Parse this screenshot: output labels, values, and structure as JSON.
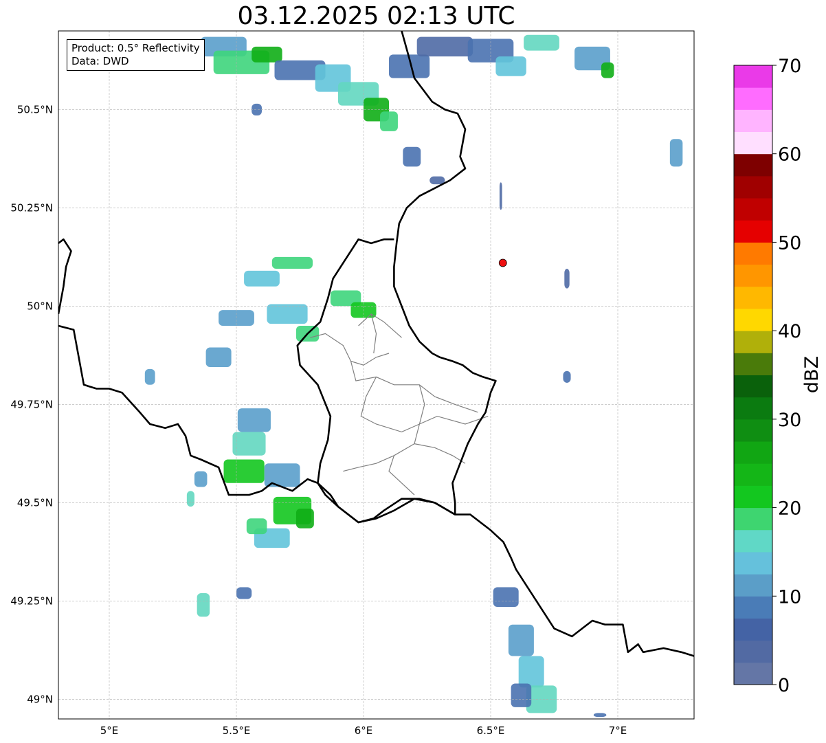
{
  "title": "03.12.2025 02:13 UTC",
  "info": {
    "product": "Product: 0.5° Reflectivity",
    "source": "Data: DWD"
  },
  "map": {
    "lon_range": [
      4.8,
      7.3
    ],
    "lat_range": [
      48.95,
      50.7
    ],
    "lon_ticks": [
      {
        "value": 5.0,
        "label": "5°E"
      },
      {
        "value": 5.5,
        "label": "5.5°E"
      },
      {
        "value": 6.0,
        "label": "6°E"
      },
      {
        "value": 6.5,
        "label": "6.5°E"
      },
      {
        "value": 7.0,
        "label": "7°E"
      }
    ],
    "lat_ticks": [
      {
        "value": 50.5,
        "label": "50.5°N"
      },
      {
        "value": 50.25,
        "label": "50.25°N"
      },
      {
        "value": 50.0,
        "label": "50°N"
      },
      {
        "value": 49.75,
        "label": "49.75°N"
      },
      {
        "value": 49.5,
        "label": "49.5°N"
      },
      {
        "value": 49.25,
        "label": "49.25°N"
      },
      {
        "value": 49.0,
        "label": "49°N"
      }
    ],
    "grid": true,
    "radar_site": {
      "lon": 6.548,
      "lat": 50.11,
      "color": "#ee1111"
    },
    "borders": [
      [
        [
          4.8,
          50.16
        ],
        [
          4.82,
          50.17
        ],
        [
          4.85,
          50.14
        ],
        [
          4.83,
          50.1
        ],
        [
          4.82,
          50.05
        ],
        [
          4.8,
          49.98
        ]
      ],
      [
        [
          4.8,
          49.95
        ],
        [
          4.86,
          49.94
        ],
        [
          4.88,
          49.87
        ],
        [
          4.9,
          49.8
        ],
        [
          4.95,
          49.79
        ],
        [
          5.0,
          49.79
        ],
        [
          5.05,
          49.78
        ],
        [
          5.12,
          49.73
        ],
        [
          5.16,
          49.7
        ],
        [
          5.22,
          49.69
        ],
        [
          5.27,
          49.7
        ],
        [
          5.3,
          49.67
        ],
        [
          5.32,
          49.62
        ],
        [
          5.36,
          49.61
        ],
        [
          5.43,
          49.59
        ],
        [
          5.47,
          49.52
        ],
        [
          5.55,
          49.52
        ],
        [
          5.6,
          49.53
        ],
        [
          5.64,
          49.55
        ],
        [
          5.72,
          49.53
        ],
        [
          5.78,
          49.56
        ],
        [
          5.82,
          49.55
        ],
        [
          5.85,
          49.52
        ],
        [
          5.9,
          49.49
        ],
        [
          5.98,
          49.45
        ],
        [
          6.04,
          49.46
        ],
        [
          6.08,
          49.48
        ],
        [
          6.15,
          49.51
        ],
        [
          6.22,
          49.51
        ],
        [
          6.28,
          49.5
        ],
        [
          6.36,
          49.47
        ],
        [
          6.42,
          49.47
        ],
        [
          6.5,
          49.43
        ],
        [
          6.55,
          49.4
        ],
        [
          6.58,
          49.36
        ],
        [
          6.6,
          49.33
        ],
        [
          6.65,
          49.28
        ],
        [
          6.7,
          49.23
        ],
        [
          6.75,
          49.18
        ],
        [
          6.82,
          49.16
        ],
        [
          6.86,
          49.18
        ],
        [
          6.9,
          49.2
        ],
        [
          6.95,
          49.19
        ],
        [
          7.02,
          49.19
        ],
        [
          7.04,
          49.12
        ],
        [
          7.08,
          49.14
        ],
        [
          7.1,
          49.12
        ],
        [
          7.18,
          49.13
        ],
        [
          7.25,
          49.12
        ],
        [
          7.3,
          49.11
        ]
      ],
      [
        [
          6.36,
          49.47
        ],
        [
          6.36,
          49.5
        ],
        [
          6.35,
          49.55
        ],
        [
          6.38,
          49.6
        ],
        [
          6.41,
          49.65
        ],
        [
          6.45,
          49.7
        ],
        [
          6.48,
          49.73
        ],
        [
          6.5,
          49.78
        ],
        [
          6.52,
          49.81
        ],
        [
          6.47,
          49.82
        ],
        [
          6.43,
          49.83
        ],
        [
          6.39,
          49.85
        ],
        [
          6.35,
          49.86
        ],
        [
          6.3,
          49.87
        ],
        [
          6.27,
          49.88
        ],
        [
          6.22,
          49.91
        ],
        [
          6.18,
          49.95
        ],
        [
          6.15,
          50.0
        ],
        [
          6.12,
          50.05
        ],
        [
          6.12,
          50.1
        ],
        [
          6.13,
          50.16
        ],
        [
          6.14,
          50.21
        ],
        [
          6.17,
          50.25
        ],
        [
          6.22,
          50.28
        ],
        [
          6.28,
          50.3
        ],
        [
          6.34,
          50.32
        ],
        [
          6.4,
          50.35
        ],
        [
          6.38,
          50.38
        ],
        [
          6.4,
          50.45
        ],
        [
          6.37,
          50.49
        ],
        [
          6.32,
          50.5
        ],
        [
          6.27,
          50.52
        ],
        [
          6.2,
          50.58
        ],
        [
          6.18,
          50.63
        ],
        [
          6.15,
          50.7
        ]
      ],
      [
        [
          6.36,
          49.47
        ],
        [
          6.28,
          49.5
        ],
        [
          6.2,
          49.51
        ],
        [
          6.12,
          49.48
        ],
        [
          6.05,
          49.46
        ],
        [
          5.98,
          49.45
        ],
        [
          5.9,
          49.49
        ],
        [
          5.87,
          49.52
        ],
        [
          5.82,
          49.55
        ],
        [
          5.83,
          49.6
        ],
        [
          5.86,
          49.66
        ],
        [
          5.87,
          49.72
        ],
        [
          5.82,
          49.8
        ],
        [
          5.75,
          49.85
        ],
        [
          5.74,
          49.9
        ],
        [
          5.78,
          49.93
        ],
        [
          5.83,
          49.96
        ],
        [
          5.86,
          50.02
        ],
        [
          5.88,
          50.07
        ],
        [
          5.93,
          50.12
        ],
        [
          5.98,
          50.17
        ],
        [
          6.03,
          50.16
        ],
        [
          6.08,
          50.17
        ],
        [
          6.12,
          50.17
        ]
      ]
    ],
    "regions": [
      [
        [
          5.79,
          49.92
        ],
        [
          5.85,
          49.93
        ],
        [
          5.92,
          49.9
        ],
        [
          5.95,
          49.86
        ]
      ],
      [
        [
          5.95,
          49.86
        ],
        [
          6.0,
          49.85
        ],
        [
          6.05,
          49.87
        ],
        [
          6.1,
          49.88
        ]
      ],
      [
        [
          5.98,
          49.95
        ],
        [
          6.03,
          49.98
        ],
        [
          6.08,
          49.96
        ],
        [
          6.15,
          49.92
        ]
      ],
      [
        [
          6.03,
          49.98
        ],
        [
          6.05,
          49.93
        ],
        [
          6.04,
          49.88
        ]
      ],
      [
        [
          5.95,
          49.86
        ],
        [
          5.97,
          49.81
        ],
        [
          6.05,
          49.82
        ],
        [
          6.12,
          49.8
        ],
        [
          6.22,
          49.8
        ],
        [
          6.28,
          49.77
        ],
        [
          6.36,
          49.75
        ],
        [
          6.45,
          49.73
        ]
      ],
      [
        [
          6.05,
          49.82
        ],
        [
          6.01,
          49.77
        ],
        [
          5.99,
          49.72
        ],
        [
          6.05,
          49.7
        ],
        [
          6.15,
          49.68
        ],
        [
          6.22,
          49.7
        ],
        [
          6.29,
          49.72
        ],
        [
          6.4,
          49.7
        ],
        [
          6.49,
          49.72
        ]
      ],
      [
        [
          6.22,
          49.8
        ],
        [
          6.24,
          49.75
        ],
        [
          6.22,
          49.7
        ],
        [
          6.2,
          49.65
        ],
        [
          6.12,
          49.62
        ],
        [
          6.05,
          49.6
        ],
        [
          5.98,
          49.59
        ],
        [
          5.92,
          49.58
        ]
      ],
      [
        [
          6.2,
          49.65
        ],
        [
          6.28,
          49.64
        ],
        [
          6.35,
          49.62
        ],
        [
          6.4,
          49.6
        ]
      ],
      [
        [
          6.12,
          49.62
        ],
        [
          6.1,
          49.58
        ],
        [
          6.15,
          49.55
        ],
        [
          6.2,
          49.52
        ]
      ]
    ],
    "echo_colors": [
      "#667ca8",
      "#4f6aa5",
      "#4a72b0",
      "#5a9fcb",
      "#62c4da",
      "#63d7c0",
      "#3ed57c",
      "#13c71f",
      "#10ae16"
    ],
    "echo_cells": [
      {
        "lon": 5.45,
        "lat": 50.66,
        "w": 0.18,
        "h": 0.05,
        "l": 3
      },
      {
        "lon": 5.52,
        "lat": 50.62,
        "w": 0.22,
        "h": 0.06,
        "l": 6
      },
      {
        "lon": 5.62,
        "lat": 50.64,
        "w": 0.12,
        "h": 0.04,
        "l": 8
      },
      {
        "lon": 5.75,
        "lat": 50.6,
        "w": 0.2,
        "h": 0.05,
        "l": 2
      },
      {
        "lon": 5.88,
        "lat": 50.58,
        "w": 0.14,
        "h": 0.07,
        "l": 4
      },
      {
        "lon": 5.98,
        "lat": 50.54,
        "w": 0.16,
        "h": 0.06,
        "l": 5
      },
      {
        "lon": 6.05,
        "lat": 50.5,
        "w": 0.1,
        "h": 0.06,
        "l": 8
      },
      {
        "lon": 6.1,
        "lat": 50.47,
        "w": 0.07,
        "h": 0.05,
        "l": 6
      },
      {
        "lon": 6.18,
        "lat": 50.61,
        "w": 0.16,
        "h": 0.06,
        "l": 2
      },
      {
        "lon": 6.32,
        "lat": 50.66,
        "w": 0.22,
        "h": 0.05,
        "l": 1
      },
      {
        "lon": 6.5,
        "lat": 50.65,
        "w": 0.18,
        "h": 0.06,
        "l": 2
      },
      {
        "lon": 6.58,
        "lat": 50.61,
        "w": 0.12,
        "h": 0.05,
        "l": 4
      },
      {
        "lon": 6.7,
        "lat": 50.67,
        "w": 0.14,
        "h": 0.04,
        "l": 5
      },
      {
        "lon": 6.9,
        "lat": 50.63,
        "w": 0.14,
        "h": 0.06,
        "l": 3
      },
      {
        "lon": 6.96,
        "lat": 50.6,
        "w": 0.05,
        "h": 0.04,
        "l": 8
      },
      {
        "lon": 5.58,
        "lat": 50.5,
        "w": 0.04,
        "h": 0.03,
        "l": 2
      },
      {
        "lon": 6.19,
        "lat": 50.38,
        "w": 0.07,
        "h": 0.05,
        "l": 2
      },
      {
        "lon": 6.29,
        "lat": 50.32,
        "w": 0.06,
        "h": 0.02,
        "l": 1
      },
      {
        "lon": 7.23,
        "lat": 50.39,
        "w": 0.05,
        "h": 0.07,
        "l": 3
      },
      {
        "lon": 6.54,
        "lat": 50.28,
        "w": 0.01,
        "h": 0.07,
        "l": 1
      },
      {
        "lon": 5.6,
        "lat": 50.07,
        "w": 0.14,
        "h": 0.04,
        "l": 4
      },
      {
        "lon": 5.72,
        "lat": 50.11,
        "w": 0.16,
        "h": 0.03,
        "l": 6
      },
      {
        "lon": 5.5,
        "lat": 49.97,
        "w": 0.14,
        "h": 0.04,
        "l": 3
      },
      {
        "lon": 5.7,
        "lat": 49.98,
        "w": 0.16,
        "h": 0.05,
        "l": 4
      },
      {
        "lon": 5.78,
        "lat": 49.93,
        "w": 0.09,
        "h": 0.04,
        "l": 6
      },
      {
        "lon": 5.93,
        "lat": 50.02,
        "w": 0.12,
        "h": 0.04,
        "l": 6
      },
      {
        "lon": 6.0,
        "lat": 49.99,
        "w": 0.1,
        "h": 0.04,
        "l": 7
      },
      {
        "lon": 5.43,
        "lat": 49.87,
        "w": 0.1,
        "h": 0.05,
        "l": 3
      },
      {
        "lon": 5.16,
        "lat": 49.82,
        "w": 0.04,
        "h": 0.04,
        "l": 3
      },
      {
        "lon": 5.57,
        "lat": 49.71,
        "w": 0.13,
        "h": 0.06,
        "l": 3
      },
      {
        "lon": 5.55,
        "lat": 49.65,
        "w": 0.13,
        "h": 0.06,
        "l": 5
      },
      {
        "lon": 5.53,
        "lat": 49.58,
        "w": 0.16,
        "h": 0.06,
        "l": 7
      },
      {
        "lon": 5.68,
        "lat": 49.57,
        "w": 0.14,
        "h": 0.06,
        "l": 3
      },
      {
        "lon": 5.72,
        "lat": 49.48,
        "w": 0.15,
        "h": 0.07,
        "l": 7
      },
      {
        "lon": 5.77,
        "lat": 49.46,
        "w": 0.07,
        "h": 0.05,
        "l": 8
      },
      {
        "lon": 5.64,
        "lat": 49.41,
        "w": 0.14,
        "h": 0.05,
        "l": 4
      },
      {
        "lon": 5.58,
        "lat": 49.44,
        "w": 0.08,
        "h": 0.04,
        "l": 6
      },
      {
        "lon": 5.36,
        "lat": 49.56,
        "w": 0.05,
        "h": 0.04,
        "l": 3
      },
      {
        "lon": 5.32,
        "lat": 49.51,
        "w": 0.03,
        "h": 0.04,
        "l": 5
      },
      {
        "lon": 5.37,
        "lat": 49.24,
        "w": 0.05,
        "h": 0.06,
        "l": 5
      },
      {
        "lon": 5.53,
        "lat": 49.27,
        "w": 0.06,
        "h": 0.03,
        "l": 2
      },
      {
        "lon": 6.8,
        "lat": 49.82,
        "w": 0.03,
        "h": 0.03,
        "l": 2
      },
      {
        "lon": 6.8,
        "lat": 50.07,
        "w": 0.02,
        "h": 0.05,
        "l": 1
      },
      {
        "lon": 6.56,
        "lat": 49.26,
        "w": 0.1,
        "h": 0.05,
        "l": 2
      },
      {
        "lon": 6.62,
        "lat": 49.15,
        "w": 0.1,
        "h": 0.08,
        "l": 3
      },
      {
        "lon": 6.66,
        "lat": 49.07,
        "w": 0.1,
        "h": 0.08,
        "l": 4
      },
      {
        "lon": 6.7,
        "lat": 49.0,
        "w": 0.12,
        "h": 0.07,
        "l": 5
      },
      {
        "lon": 6.62,
        "lat": 49.01,
        "w": 0.08,
        "h": 0.06,
        "l": 2
      },
      {
        "lon": 6.93,
        "lat": 48.96,
        "w": 0.05,
        "h": 0.01,
        "l": 2
      }
    ]
  },
  "colorbar": {
    "label": "dBZ",
    "vmin": 0,
    "vmax": 70,
    "ticks": [
      0,
      10,
      20,
      30,
      40,
      50,
      60,
      70
    ],
    "colors": [
      "#6476a6",
      "#526aa3",
      "#4463a5",
      "#4a7cb7",
      "#5b9ec8",
      "#65c1dc",
      "#60d8c6",
      "#3ed570",
      "#13c71f",
      "#14b617",
      "#11a613",
      "#0f8e12",
      "#0b7b10",
      "#0a610b",
      "#4a7b0a",
      "#b0b00a",
      "#ffd800",
      "#ffb800",
      "#ff9600",
      "#ff7a00",
      "#e50000",
      "#c00000",
      "#a00000",
      "#7e0000",
      "#ffdfff",
      "#ffb4ff",
      "#ff6cff",
      "#ea3ae8"
    ]
  }
}
